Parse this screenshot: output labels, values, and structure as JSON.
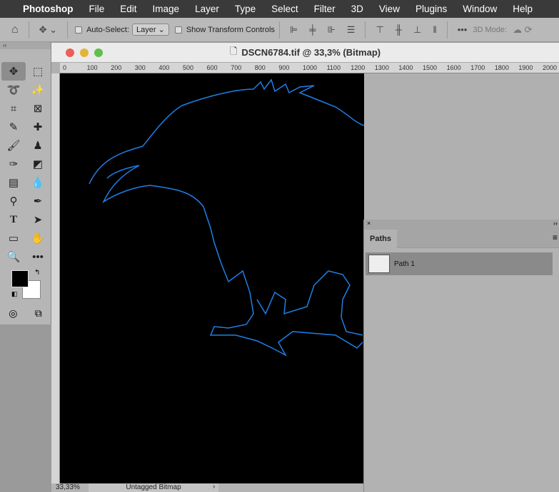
{
  "menubar": {
    "app": "Photoshop",
    "items": [
      "File",
      "Edit",
      "Image",
      "Layer",
      "Type",
      "Select",
      "Filter",
      "3D",
      "View",
      "Plugins",
      "Window",
      "Help"
    ]
  },
  "options": {
    "auto_select_label": "Auto-Select:",
    "auto_select_value": "Layer",
    "transform_label": "Show Transform Controls",
    "mode3d": "3D Mode:"
  },
  "document": {
    "title": "DSCN6784.tif @ 33,3% (Bitmap)",
    "ruler_h": [
      "0",
      "100",
      "200",
      "300",
      "400",
      "500",
      "600",
      "700",
      "800",
      "900",
      "1000",
      "1100",
      "1200",
      "1300",
      "1400",
      "1500",
      "1600",
      "1700",
      "1800",
      "1900",
      "2000"
    ],
    "zoom": "33,33%",
    "profile": "Untagged Bitmap"
  },
  "paths_panel": {
    "tab": "Paths",
    "items": [
      "Path 1"
    ]
  },
  "colors": {
    "path": "#1f7fe6"
  }
}
